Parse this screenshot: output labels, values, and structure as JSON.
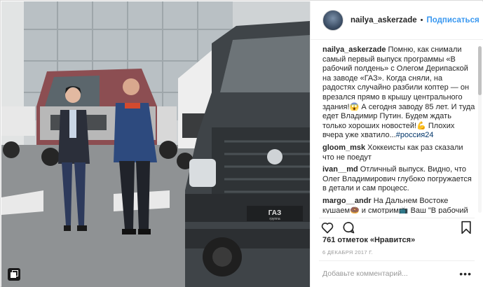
{
  "post": {
    "username": "nailya_askerzade",
    "separator": "•",
    "follow_label": "Подписаться"
  },
  "comments": [
    {
      "user": "nailya_askerzade",
      "text": "Помню, как снимали самый первый выпуск программы «В рабочий полдень» с Олегом Дерипаской на заводе «ГАЗ». Когда сняли, на радостях случайно разбили коптер — он врезался прямо в крышу центрального здания!😱 А сегодня заводу 85 лет. И туда едет Владимир Путин. Будем ждать только хороших новостей!💪 Плохих вчера уже хватило...",
      "tag": "#россия24"
    },
    {
      "user": "gloom_msk",
      "text": "Хоккеисты как раз сказали что не поедут"
    },
    {
      "user": "ivan__md",
      "text": "Отличный выпуск. Видно, что Олег Владимирович глубоко погружается в детали и сам процесс."
    },
    {
      "user": "margo__andr",
      "text": "На Дальнем Востоке кушаем🍩 и смотрим📺 Ваш \"В рабочий"
    }
  ],
  "likes": {
    "text": "761 отметок «Нравится»"
  },
  "date": {
    "text": "6 ДЕКАБРЯ 2017 Г."
  },
  "add_comment": {
    "placeholder": "Добавьте комментарий...",
    "more": "•••"
  },
  "icons": {
    "like": "heart-icon",
    "comment": "comment-bubble-icon",
    "save": "bookmark-icon",
    "carousel": "carousel-icon"
  },
  "photo": {
    "truck_badge": "ГАЗ",
    "truck_badge_sub": "группа"
  },
  "colors": {
    "follow": "#3897f0",
    "hashtag": "#003569",
    "border": "#dbdbdb",
    "meta": "#999999"
  }
}
